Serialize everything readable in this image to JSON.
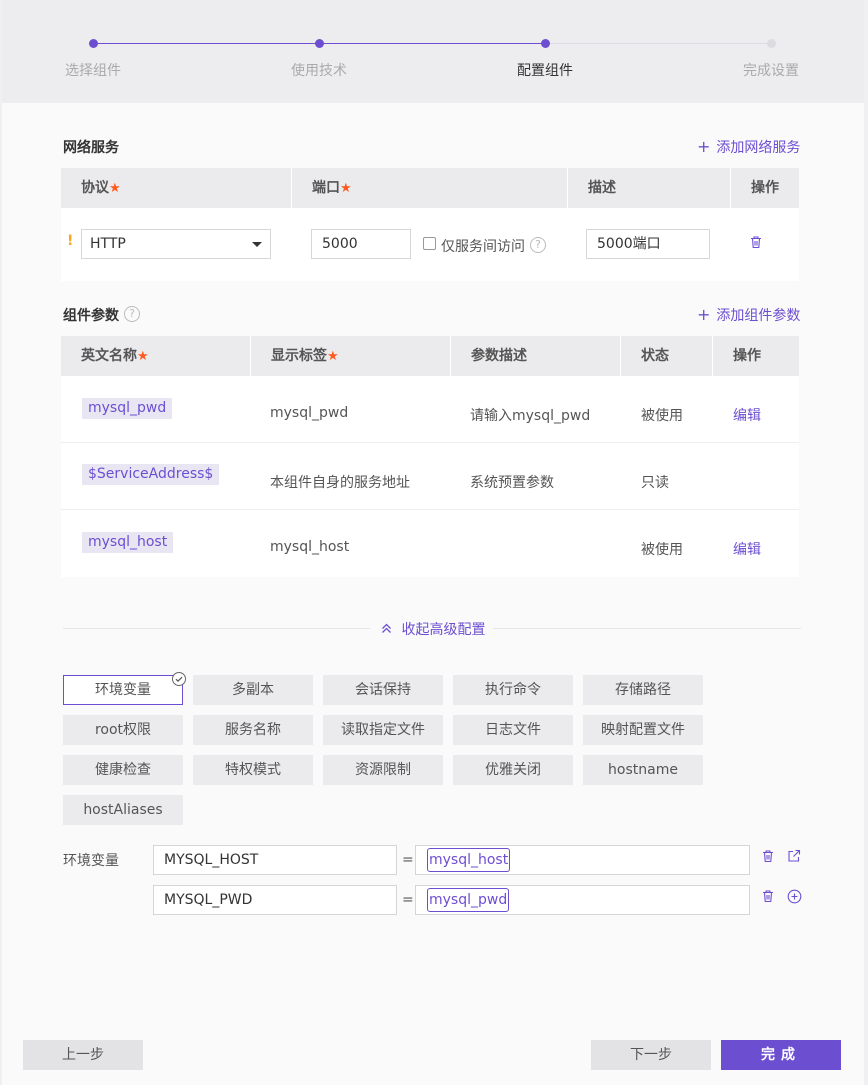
{
  "steps": [
    {
      "label": "选择组件",
      "state": "done"
    },
    {
      "label": "使用技术",
      "state": "done"
    },
    {
      "label": "配置组件",
      "state": "active"
    },
    {
      "label": "完成设置",
      "state": "pending"
    }
  ],
  "colors": {
    "accent": "#6c4fd1",
    "required": "#ff5a1f",
    "warning": "#f5a623"
  },
  "network": {
    "title": "网络服务",
    "add_label": "添加网络服务",
    "columns": {
      "protocol": "协议",
      "port": "端口",
      "desc": "描述",
      "action": "操作"
    },
    "row": {
      "warning": "!",
      "protocol": "HTTP",
      "port": "5000",
      "internal_only_label": "仅服务间访问",
      "internal_only_checked": false,
      "desc": "5000端口",
      "delete_icon": "trash-icon"
    }
  },
  "params": {
    "title": "组件参数",
    "add_label": "添加组件参数",
    "columns": {
      "name": "英文名称",
      "label": "显示标签",
      "desc": "参数描述",
      "status": "状态",
      "action": "操作"
    },
    "rows": [
      {
        "name": "mysql_pwd",
        "label": "mysql_pwd",
        "desc": "请输入mysql_pwd",
        "status": "被使用",
        "action": "编辑"
      },
      {
        "name": "$ServiceAddress$",
        "label": "本组件自身的服务地址",
        "desc": "系统预置参数",
        "status": "只读",
        "action": ""
      },
      {
        "name": "mysql_host",
        "label": "mysql_host",
        "desc": "",
        "status": "被使用",
        "action": "编辑"
      }
    ]
  },
  "advanced": {
    "collapse_label": "收起高级配置",
    "chips": [
      "环境变量",
      "多副本",
      "会话保持",
      "执行命令",
      "存储路径",
      "root权限",
      "服务名称",
      "读取指定文件",
      "日志文件",
      "映射配置文件",
      "健康检查",
      "特权模式",
      "资源限制",
      "优雅关闭",
      "hostname",
      "hostAliases"
    ],
    "selected": "环境变量"
  },
  "env": {
    "label": "环境变量",
    "rows": [
      {
        "key": "MYSQL_HOST",
        "eq": "=",
        "value": "mysql_host",
        "icons": [
          "trash-icon",
          "external-link-icon"
        ]
      },
      {
        "key": "MYSQL_PWD",
        "eq": "=",
        "value": "mysql_pwd",
        "icons": [
          "trash-icon",
          "add-circle-icon"
        ]
      }
    ]
  },
  "footer": {
    "prev": "上一步",
    "next": "下一步",
    "finish": "完成"
  }
}
